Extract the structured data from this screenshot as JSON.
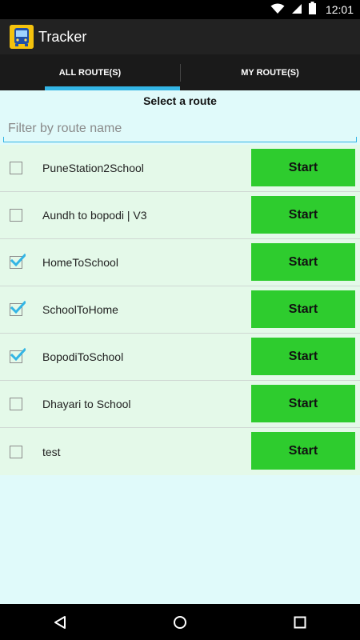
{
  "status_bar": {
    "time": "12:01"
  },
  "app": {
    "title": "Tracker"
  },
  "tabs": [
    {
      "label": "ALL ROUTE(S)",
      "selected": true
    },
    {
      "label": "MY ROUTE(S)",
      "selected": false
    }
  ],
  "main": {
    "heading": "Select a route",
    "filter_placeholder": "Filter by route name",
    "filter_value": ""
  },
  "routes": [
    {
      "name": "PuneStation2School",
      "checked": false,
      "button_label": "Start"
    },
    {
      "name": "Aundh to bopodi | V3",
      "checked": false,
      "button_label": "Start"
    },
    {
      "name": "HomeToSchool",
      "checked": true,
      "button_label": "Start"
    },
    {
      "name": "SchoolToHome",
      "checked": true,
      "button_label": "Start"
    },
    {
      "name": "BopodiToSchool",
      "checked": true,
      "button_label": "Start"
    },
    {
      "name": "Dhayari to School",
      "checked": false,
      "button_label": "Start"
    },
    {
      "name": "test",
      "checked": false,
      "button_label": "Start"
    }
  ],
  "colors": {
    "accent": "#33b5e5",
    "start_button": "#2ecc2e",
    "list_background": "#e4f9e9",
    "page_background": "#e0fafa"
  },
  "icons": {
    "status": [
      "wifi-icon",
      "signal-icon",
      "battery-icon"
    ],
    "nav": [
      "back-icon",
      "home-icon",
      "recents-icon"
    ]
  }
}
